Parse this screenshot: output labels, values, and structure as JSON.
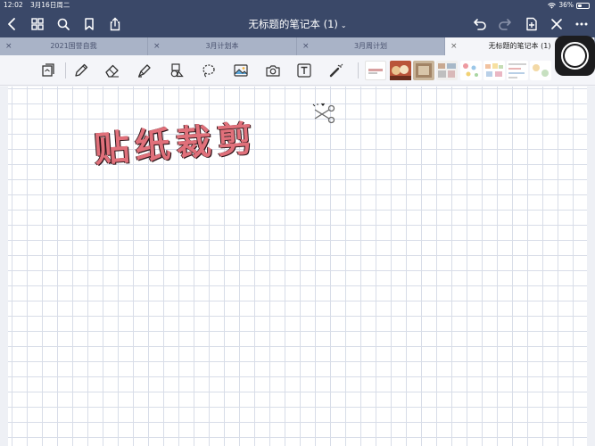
{
  "status_bar": {
    "time": "12:02",
    "date": "3月16日周二",
    "battery_percent": "36%",
    "battery_level": 0.36
  },
  "title_bar": {
    "title": "无标题的笔记本 (1)",
    "chevron": "⌄"
  },
  "tabs": [
    {
      "label": "2021国誉自我",
      "close": "×",
      "active": false
    },
    {
      "label": "3月计划本",
      "close": "×",
      "active": false
    },
    {
      "label": "3月周计划",
      "close": "×",
      "active": false
    },
    {
      "label": "无标题的笔记本 (1)",
      "close": "×",
      "active": true
    }
  ],
  "canvas": {
    "handwriting": "贴纸裁剪"
  },
  "colors": {
    "header_bg": "#3a4868",
    "tab_bar_bg": "#a9b3c7",
    "handwriting": "#e0707a"
  },
  "icons": {
    "back": "chevron-left-icon",
    "grid": "grid-icon",
    "search": "search-icon",
    "bookmark": "bookmark-icon",
    "share": "share-icon",
    "undo": "undo-icon",
    "redo": "redo-icon",
    "add_page": "add-page-icon",
    "close": "close-icon",
    "more": "more-icon"
  }
}
